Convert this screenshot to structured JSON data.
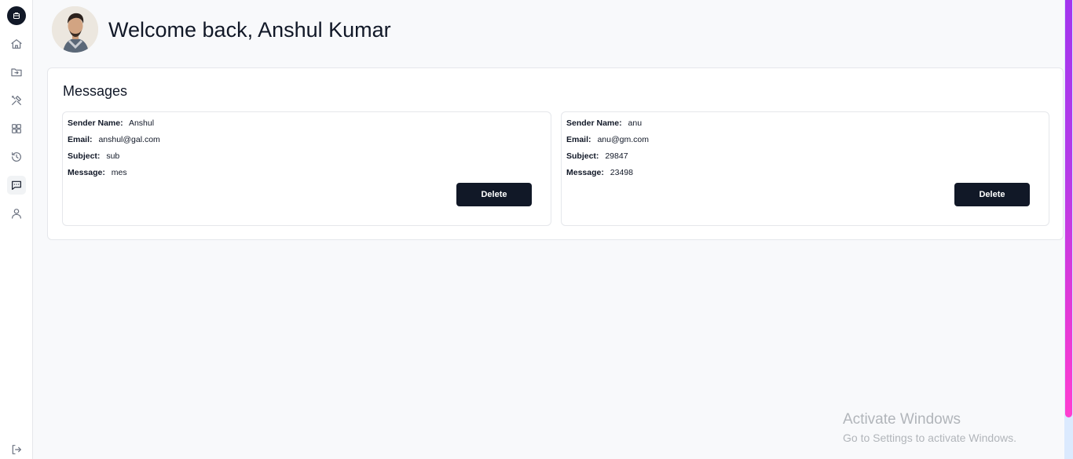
{
  "header": {
    "welcome_text": "Welcome back, Anshul Kumar"
  },
  "sidebar": {
    "items": [
      {
        "icon": "home-icon"
      },
      {
        "icon": "folder-icon"
      },
      {
        "icon": "tools-icon"
      },
      {
        "icon": "grid-icon"
      },
      {
        "icon": "history-icon"
      },
      {
        "icon": "message-icon",
        "active": true
      },
      {
        "icon": "user-icon"
      }
    ],
    "logout_icon": "logout-icon"
  },
  "messages": {
    "title": "Messages",
    "labels": {
      "sender": "Sender Name:",
      "email": "Email:",
      "subject": "Subject:",
      "message": "Message:"
    },
    "delete_label": "Delete",
    "items": [
      {
        "sender": "Anshul",
        "email": "anshul@gal.com",
        "subject": "sub",
        "message": "mes"
      },
      {
        "sender": "anu",
        "email": "anu@gm.com",
        "subject": "29847",
        "message": "23498"
      }
    ]
  },
  "watermark": {
    "title": "Activate Windows",
    "subtitle": "Go to Settings to activate Windows."
  },
  "colors": {
    "primary": "#111827",
    "background": "#f8f9fb",
    "scroll_accent": "#c03be6"
  }
}
